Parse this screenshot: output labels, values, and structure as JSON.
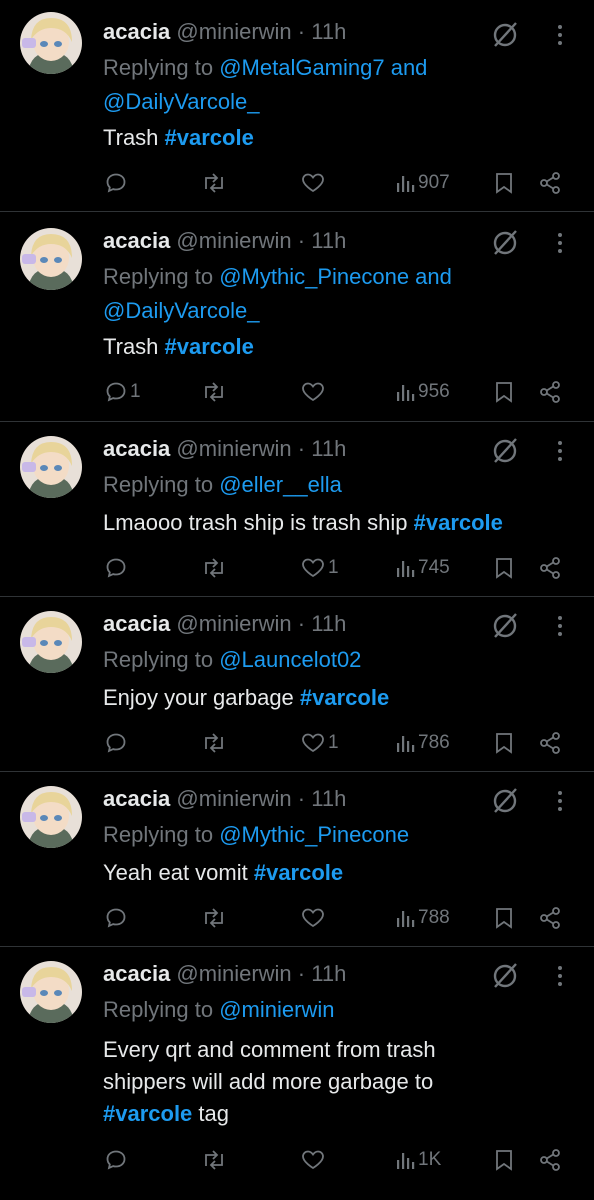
{
  "tweets": [
    {
      "author_name": "acacia",
      "handle": "@minierwin",
      "time": "· 11h",
      "replying_prefix": "Replying to",
      "reply_targets": "@MetalGaming7 and",
      "reply_targets_line2": "@DailyVarcole_",
      "text_lines": [
        "Trash "
      ],
      "hashtag": "#varcole",
      "replies": "",
      "likes": "",
      "views": "907"
    },
    {
      "author_name": "acacia",
      "handle": "@minierwin",
      "time": "· 11h",
      "replying_prefix": "Replying to",
      "reply_targets": "@Mythic_Pinecone and",
      "reply_targets_line2": "@DailyVarcole_",
      "text_lines": [
        "Trash "
      ],
      "hashtag": "#varcole",
      "replies": "1",
      "likes": "",
      "views": "956"
    },
    {
      "author_name": "acacia",
      "handle": "@minierwin",
      "time": "· 11h",
      "replying_prefix": "Replying to",
      "reply_targets": "@eller__ella",
      "text_lines": [
        "Lmaooo trash ship is trash ship "
      ],
      "hashtag": "#varcole",
      "replies": "",
      "likes": "1",
      "views": "745"
    },
    {
      "author_name": "acacia",
      "handle": "@minierwin",
      "time": "· 11h",
      "replying_prefix": "Replying to",
      "reply_targets": "@Launcelot02",
      "text_lines": [
        "Enjoy your garbage "
      ],
      "hashtag": "#varcole",
      "replies": "",
      "likes": "1",
      "views": "786"
    },
    {
      "author_name": "acacia",
      "handle": "@minierwin",
      "time": "· 11h",
      "replying_prefix": "Replying to",
      "reply_targets": "@Mythic_Pinecone",
      "text_lines": [
        "Yeah eat vomit "
      ],
      "hashtag": "#varcole",
      "replies": "",
      "likes": "",
      "views": "788"
    },
    {
      "author_name": "acacia",
      "handle": "@minierwin",
      "time": "· 11h",
      "replying_prefix": "Replying to",
      "reply_targets": "@minierwin",
      "text_lines": [
        "Every qrt and comment from trash",
        "shippers will add more garbage to"
      ],
      "hashtag": "#varcole",
      "text_suffix": " tag",
      "replies": "",
      "likes": "",
      "views": "1K"
    }
  ],
  "colors": {
    "link": "#1d9bf0",
    "muted": "#71767b",
    "text": "#e7e9ea",
    "divider": "#2f3336"
  }
}
